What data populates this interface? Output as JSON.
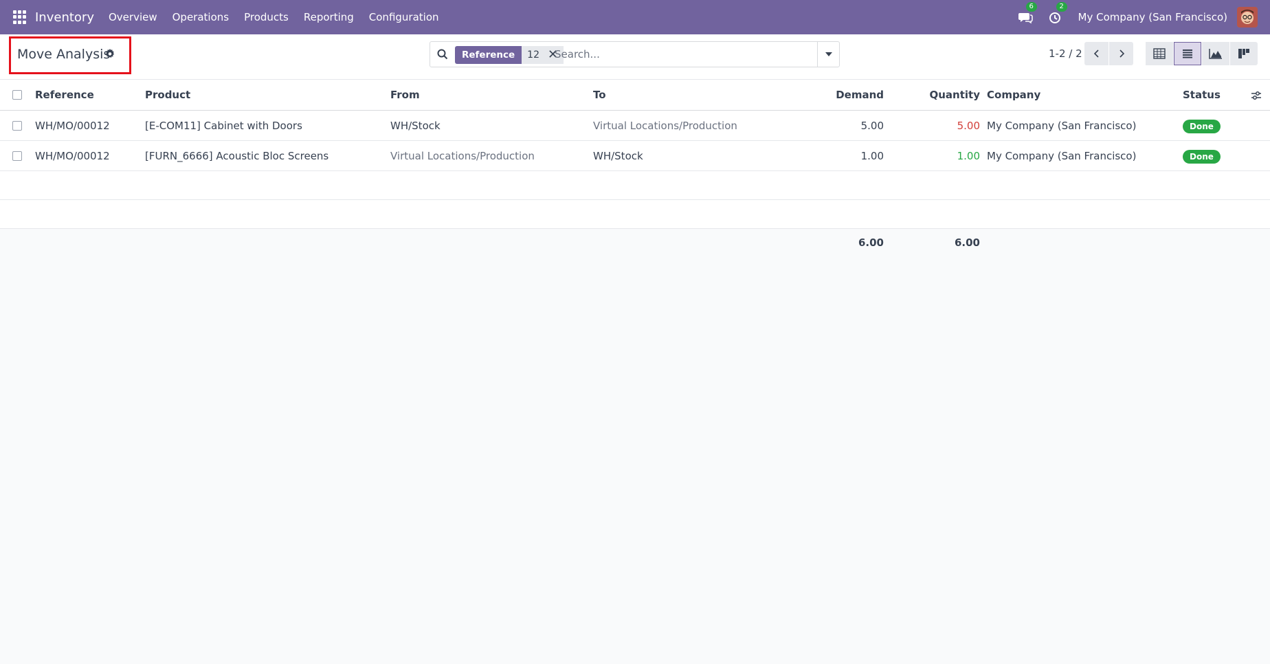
{
  "navbar": {
    "app_name": "Inventory",
    "menu": [
      "Overview",
      "Operations",
      "Products",
      "Reporting",
      "Configuration"
    ],
    "messages_badge": "6",
    "activities_badge": "2",
    "company": "My Company (San Francisco)"
  },
  "control": {
    "title": "Move Analysis",
    "search": {
      "facet_label": "Reference",
      "facet_value": "12",
      "placeholder": "Search..."
    },
    "pager": "1-2 / 2"
  },
  "table": {
    "columns": [
      "Reference",
      "Product",
      "From",
      "To",
      "Demand",
      "Quantity",
      "Company",
      "Status"
    ],
    "rows": [
      {
        "reference": "WH/MO/00012",
        "product": "[E-COM11] Cabinet with Doors",
        "from": "WH/Stock",
        "to": "Virtual Locations/Production",
        "demand": "5.00",
        "quantity": "5.00",
        "company": "My Company (San Francisco)",
        "status": "Done"
      },
      {
        "reference": "WH/MO/00012",
        "product": "[FURN_6666] Acoustic Bloc Screens",
        "from": "Virtual Locations/Production",
        "to": "WH/Stock",
        "demand": "1.00",
        "quantity": "1.00",
        "company": "My Company (San Francisco)",
        "status": "Done"
      }
    ],
    "totals": {
      "demand": "6.00",
      "quantity": "6.00"
    }
  },
  "colors": {
    "brand": "#71639e",
    "done": "#28a745",
    "negative": "#d23f3a",
    "positive": "#28a745",
    "highlight": "#e5111b"
  },
  "icons": [
    "apps-icon",
    "chat-icon",
    "clock-icon",
    "gear-icon",
    "search-icon",
    "close-icon",
    "chevron-left-icon",
    "chevron-right-icon",
    "pivot-icon",
    "list-icon",
    "graph-icon",
    "kanban-icon",
    "column-settings-icon"
  ]
}
